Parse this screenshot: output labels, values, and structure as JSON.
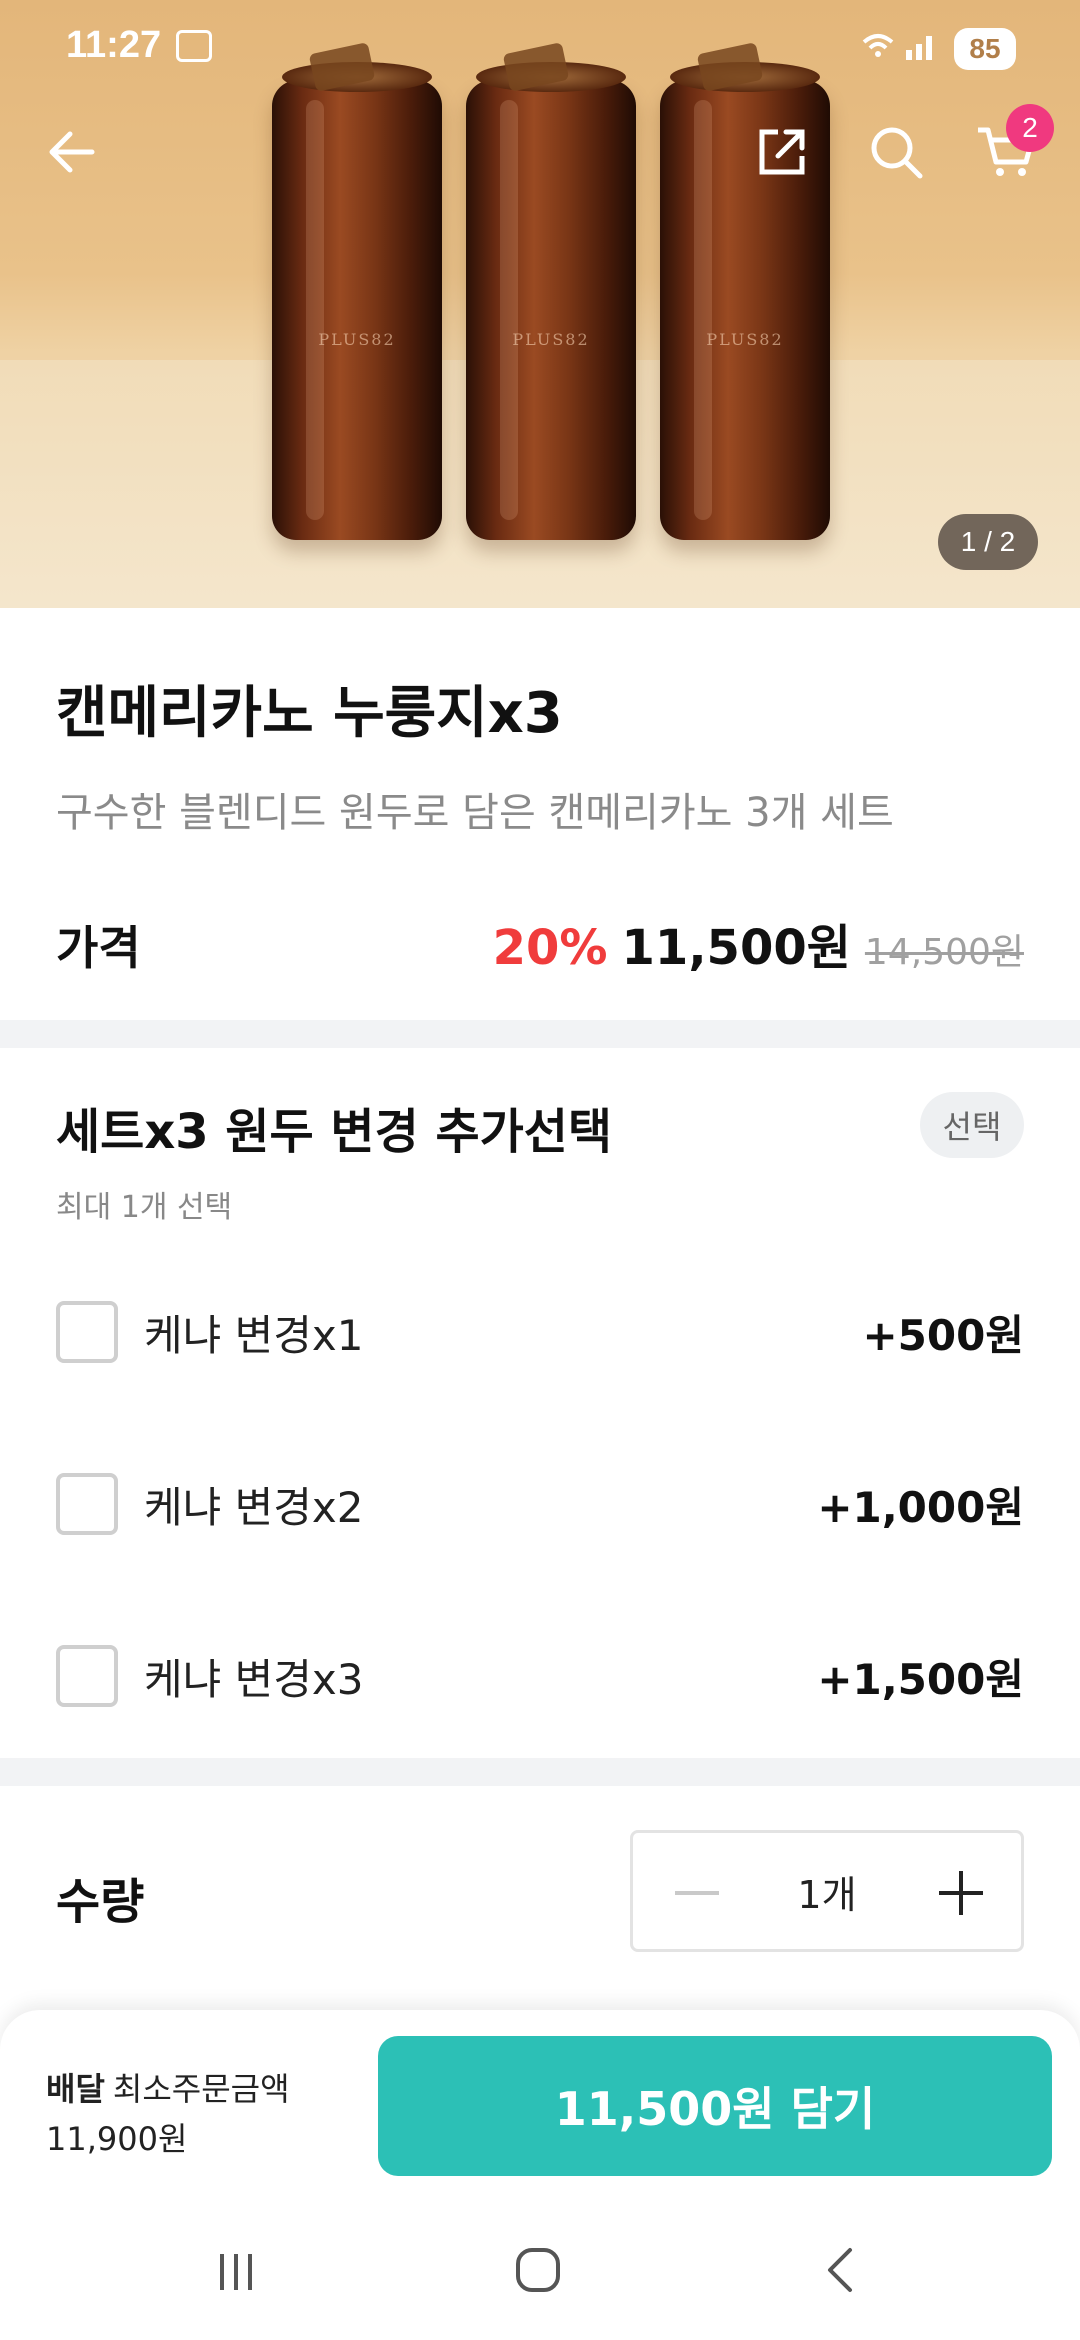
{
  "status_bar": {
    "time": "11:27",
    "battery": "85"
  },
  "hero": {
    "can_label": "PLUS82",
    "pager": "1 / 2",
    "cart_count": "2"
  },
  "product": {
    "title": "캔메리카노 누룽지x3",
    "subtitle": "구수한 블렌디드 원두로 담은 캔메리카노 3개 세트",
    "price_label": "가격",
    "discount": "20%",
    "price": "11,500원",
    "original_price": "14,500원"
  },
  "options": {
    "title": "세트x3 원두 변경 추가선택",
    "badge": "선택",
    "subtitle": "최대 1개 선택",
    "items": [
      {
        "name": "케냐 변경x1",
        "price": "+500원"
      },
      {
        "name": "케냐 변경x2",
        "price": "+1,000원"
      },
      {
        "name": "케냐 변경x3",
        "price": "+1,500원"
      }
    ]
  },
  "quantity": {
    "label": "수량",
    "value": "1개"
  },
  "bottom_bar": {
    "delivery_label": "배달",
    "min_order_label": "최소주문금액",
    "min_order_amount": "11,900원",
    "add_button": "11,500원 담기"
  },
  "colors": {
    "accent": "#2cc0b6",
    "discount": "#f03c3c",
    "badge": "#f0397f"
  }
}
